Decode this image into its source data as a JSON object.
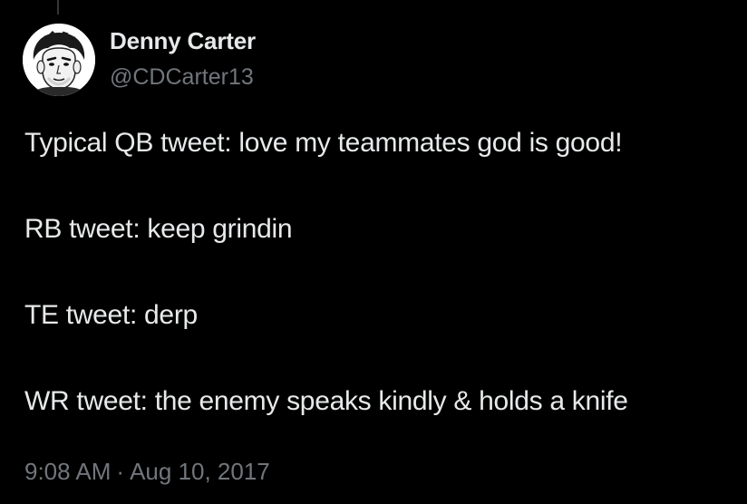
{
  "colors": {
    "background": "#000000",
    "primary_text": "#e7e9ea",
    "secondary_text": "#71767b",
    "thread_line": "#333639"
  },
  "author": {
    "name": "Denny Carter",
    "handle": "@CDCarter13",
    "avatar_icon": "cartoon-portrait-avatar"
  },
  "tweet": {
    "lines": [
      "Typical QB tweet: love my teammates god is good!",
      "RB tweet: keep grindin",
      "TE tweet: derp",
      "WR tweet: the enemy speaks kindly & holds a knife"
    ],
    "time": "9:08 AM",
    "separator": "·",
    "date": "Aug 10, 2017"
  }
}
